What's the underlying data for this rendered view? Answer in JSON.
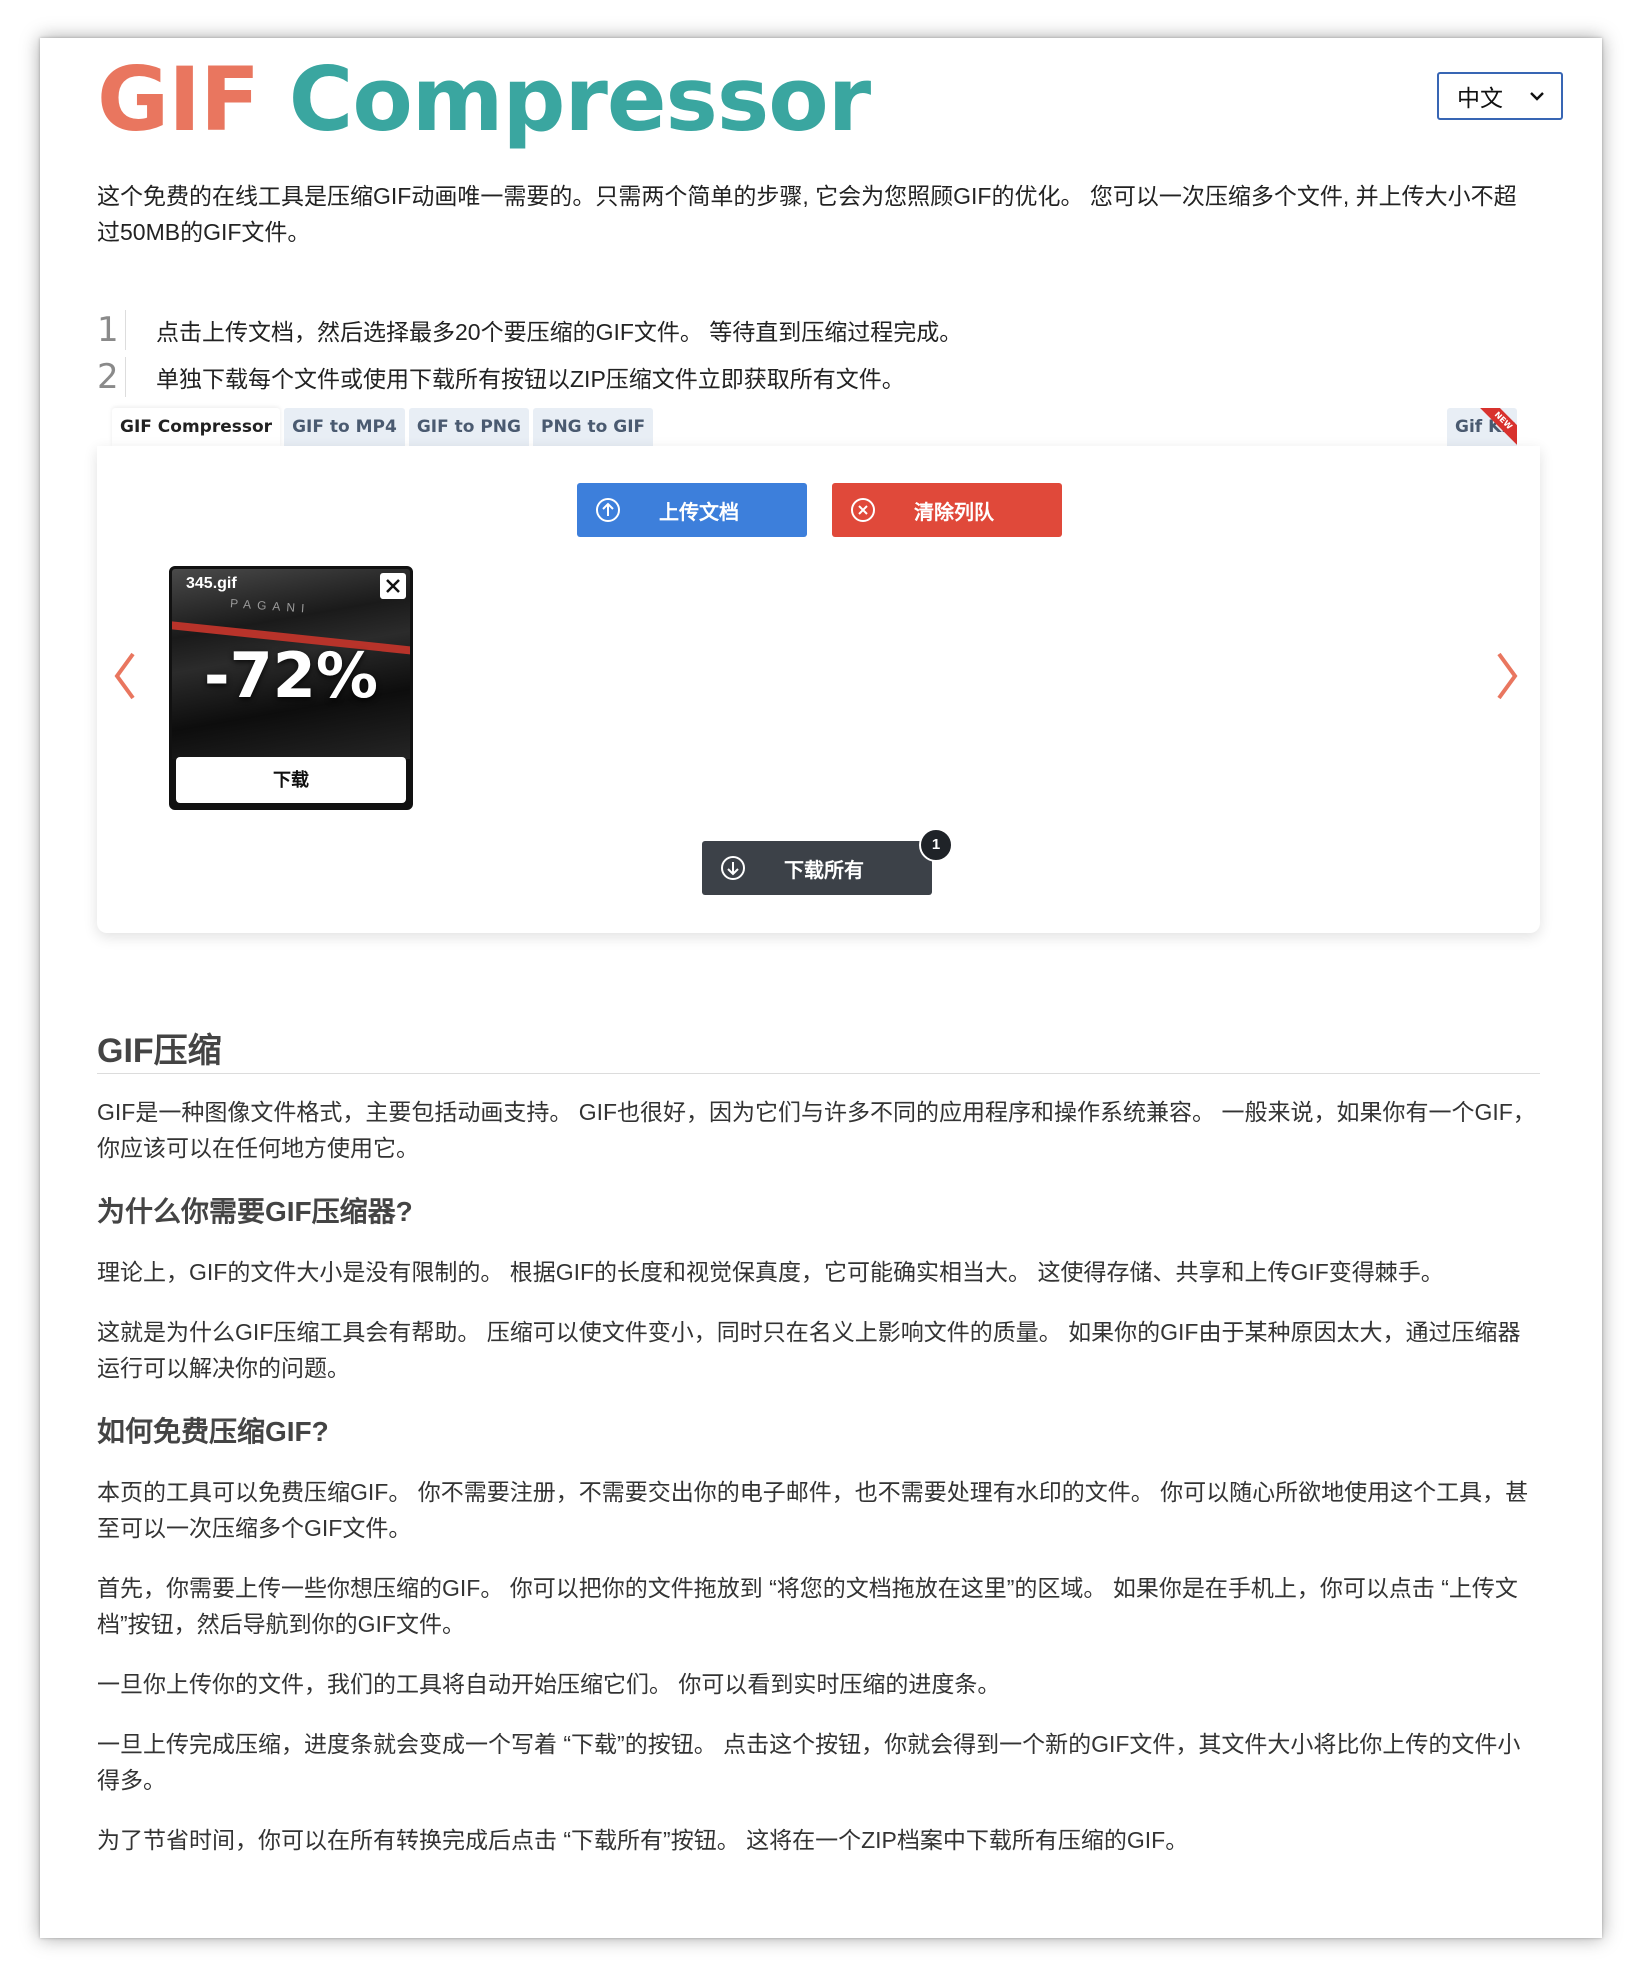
{
  "header": {
    "logo_word1": "GIF",
    "logo_word2": "Compressor",
    "language": "中文"
  },
  "intro": "这个免费的在线工具是压缩GIF动画唯一需要的。只需两个简单的步骤, 它会为您照顾GIF的优化。 您可以一次压缩多个文件, 并上传大小不超过50MB的GIF文件。",
  "steps": [
    {
      "num": "1",
      "text": "点击上传文档，然后选择最多20个要压缩的GIF文件。 等待直到压缩过程完成。"
    },
    {
      "num": "2",
      "text": "单独下载每个文件或使用下载所有按钮以ZIP压缩文件立即获取所有文件。"
    }
  ],
  "tabs": [
    "GIF Compressor",
    "GIF to MP4",
    "GIF to PNG",
    "PNG to GIF"
  ],
  "tab_right": "Gif Kit",
  "tab_right_badge": "NEW",
  "tool": {
    "upload_label": "上传文档",
    "clear_label": "清除列队",
    "download_all_label": "下载所有",
    "download_all_count": "1",
    "file": {
      "name": "345.gif",
      "reduction": "-72%",
      "download_label": "下载",
      "image_text": "PAGANI"
    }
  },
  "article": {
    "title": "GIF压缩",
    "p1": "GIF是一种图像文件格式，主要包括动画支持。 GIF也很好，因为它们与许多不同的应用程序和操作系统兼容。 一般来说，如果你有一个GIF，你应该可以在任何地方使用它。",
    "h_why": "为什么你需要GIF压缩器?",
    "p2": "理论上，GIF的文件大小是没有限制的。 根据GIF的长度和视觉保真度，它可能确实相当大。 这使得存储、共享和上传GIF变得棘手。",
    "p3": "这就是为什么GIF压缩工具会有帮助。 压缩可以使文件变小，同时只在名义上影响文件的质量。 如果你的GIF由于某种原因太大，通过压缩器运行可以解决你的问题。",
    "h_how": "如何免费压缩GIF?",
    "p4": "本页的工具可以免费压缩GIF。 你不需要注册，不需要交出你的电子邮件，也不需要处理有水印的文件。 你可以随心所欲地使用这个工具，甚至可以一次压缩多个GIF文件。",
    "p5": "首先，你需要上传一些你想压缩的GIF。 你可以把你的文件拖放到 “将您的文档拖放在这里”的区域。 如果你是在手机上，你可以点击 “上传文档”按钮，然后导航到你的GIF文件。",
    "p6": "一旦你上传你的文件，我们的工具将自动开始压缩它们。 你可以看到实时压缩的进度条。",
    "p7": "一旦上传完成压缩，进度条就会变成一个写着 “下载”的按钮。 点击这个按钮，你就会得到一个新的GIF文件，其文件大小将比你上传的文件小得多。",
    "p8": "为了节省时间，你可以在所有转换完成后点击 “下载所有”按钮。 这将在一个ZIP档案中下载所有压缩的GIF。"
  },
  "colors": {
    "logo_gif": "#e9765f",
    "logo_compressor": "#3aa6a0",
    "upload": "#3d7fdb",
    "clear": "#e0493a",
    "download_all": "#3c4148",
    "arrows": "#e9765f"
  }
}
